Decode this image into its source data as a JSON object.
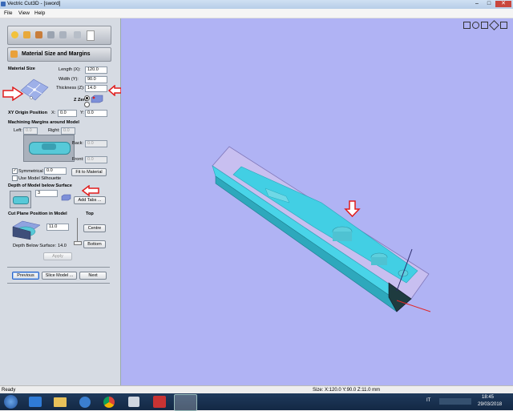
{
  "window": {
    "title": "Vectric Cut3D - [sword]",
    "minimize": "–",
    "maximize": "□",
    "close": "✕"
  },
  "menu": [
    "File",
    "View",
    "Help"
  ],
  "toolbar_icons": [
    "open-icon",
    "orientation-icon",
    "material-icon",
    "toolpath-icon",
    "preview-icon",
    "save-icon",
    "document-icon"
  ],
  "panel": {
    "title": "Material Size and Margins",
    "material_size": {
      "heading": "Material Size",
      "length_label": "Length (X):",
      "length": "120.0",
      "width_label": "Width (Y):",
      "width": "90.0",
      "thickness_label": "Thickness (Z):",
      "thickness": "14.0",
      "zzero_label": "Z Zero"
    },
    "xy_origin": {
      "heading": "XY Origin Position",
      "x_label": "X:",
      "x": "0.0",
      "y_label": "Y:",
      "y": "0.0"
    },
    "margins": {
      "heading": "Machining Margins around Model",
      "left_label": "Left:",
      "left": "0.0",
      "right_label": "Right:",
      "right": "0.0",
      "back_label": "Back:",
      "back": "0.0",
      "front_label": "Front:",
      "front": "0.0",
      "symmetrical_label": "Symmetrical",
      "symmetrical_value": "0.0",
      "silhouette_label": "Use Model Silhouette",
      "fit_button": "Fit to Material"
    },
    "depth": {
      "heading": "Depth of Model below Surface",
      "value": "3",
      "add_tabs": "Add Tabs ..."
    },
    "cut_plane": {
      "heading": "Cut Plane Position in Model",
      "top_label": "Top",
      "value": "11.0",
      "centre_button": "Centre",
      "bottom_button": "Bottom",
      "depth_below_label": "Depth Below Surface:",
      "depth_below": "14.0",
      "apply_button": "Apply"
    },
    "nav": {
      "previous": "Previous",
      "slice": "Slice Model ...",
      "next": "Next"
    }
  },
  "view_icons": [
    "zoom-extents-icon",
    "pan-icon",
    "rotate-icon",
    "view-iso-icon",
    "view-top-icon"
  ],
  "status": {
    "left": "Ready",
    "size": "Size: X:120.0 Y:90.0 Z:11.0 mm"
  },
  "taskbar": {
    "lang": "IT",
    "time": "18:45",
    "date": "29/03/2018"
  }
}
